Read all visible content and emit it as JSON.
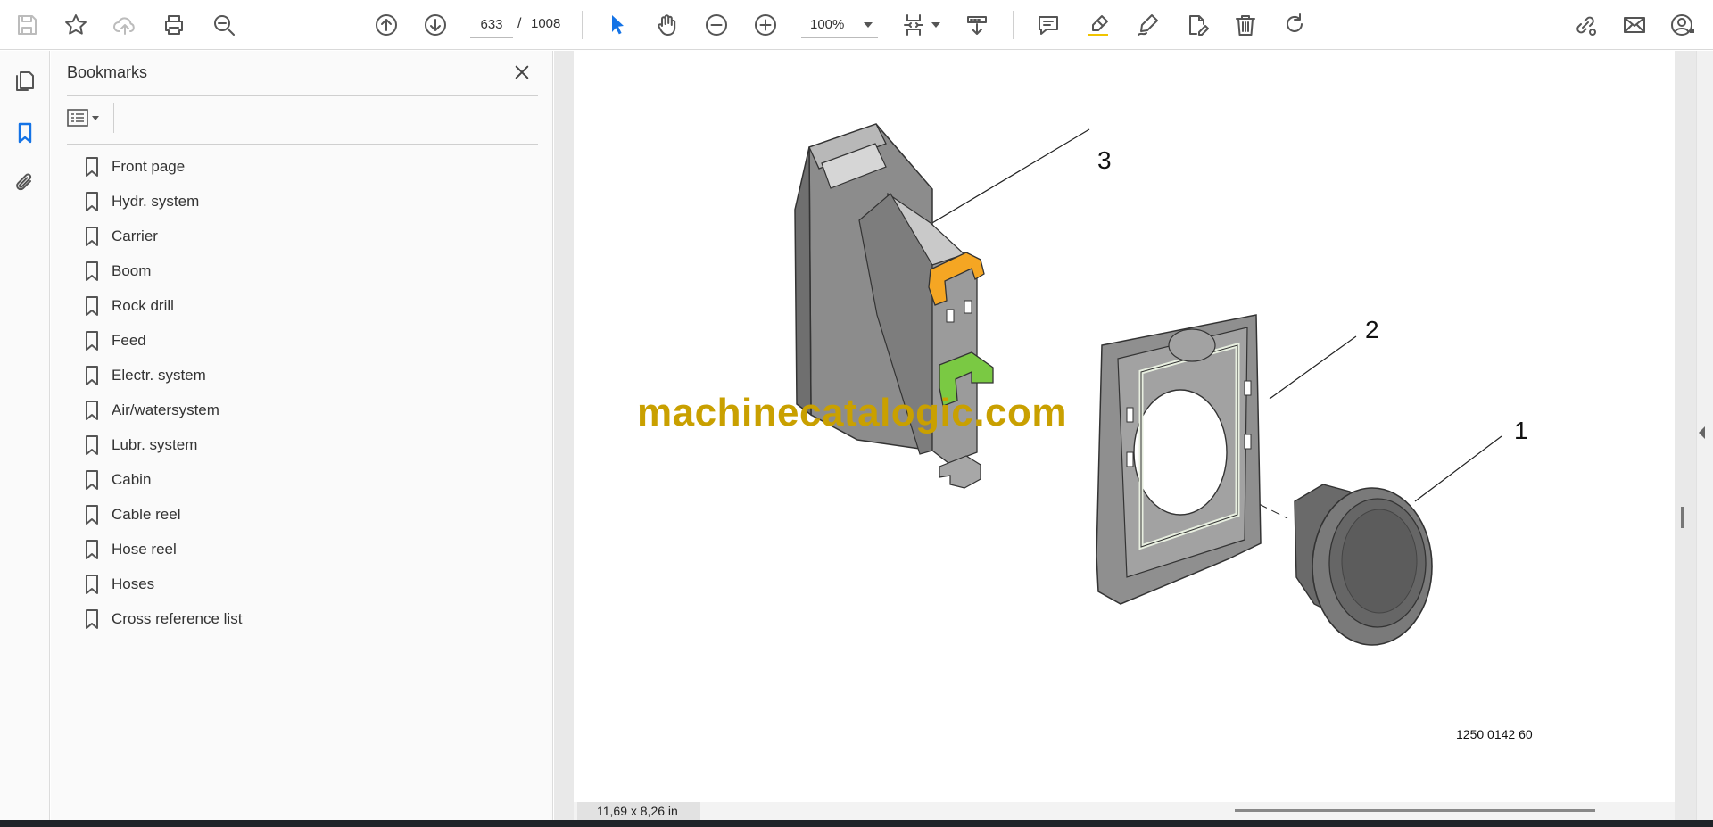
{
  "toolbar": {
    "page_current": "633",
    "page_separator": "/",
    "page_total": "1008",
    "zoom_value": "100%"
  },
  "bookmarks": {
    "title": "Bookmarks",
    "items": [
      {
        "label": "Front page"
      },
      {
        "label": "Hydr. system"
      },
      {
        "label": "Carrier"
      },
      {
        "label": "Boom"
      },
      {
        "label": "Rock drill"
      },
      {
        "label": "Feed"
      },
      {
        "label": "Electr. system"
      },
      {
        "label": "Air/watersystem"
      },
      {
        "label": "Lubr. system"
      },
      {
        "label": "Cabin"
      },
      {
        "label": "Cable reel"
      },
      {
        "label": "Hose reel"
      },
      {
        "label": "Hoses"
      },
      {
        "label": "Cross reference list"
      }
    ]
  },
  "document": {
    "watermark": "machinecatalogic.com",
    "figure_id": "1250 0142 60",
    "callouts": [
      "3",
      "2",
      "1"
    ],
    "part_colors": {
      "clip": "#f5a623",
      "latch": "#7ac943",
      "body": "#8a8a8a"
    }
  },
  "status": {
    "page_size": "11,69 x 8,26 in"
  },
  "icons": [
    "save-icon",
    "star-icon",
    "cloud-upload-icon",
    "print-icon",
    "zoom-search-icon",
    "page-up-icon",
    "page-down-icon",
    "zoom-out-icon",
    "zoom-in-icon",
    "select-cursor-icon",
    "hand-tool-icon",
    "fit-page-icon",
    "scroll-mode-icon",
    "comment-icon",
    "highlight-icon",
    "draw-icon",
    "fill-sign-icon",
    "delete-icon",
    "rotate-icon",
    "share-link-icon",
    "email-icon",
    "account-icon",
    "pages-icon",
    "bookmark-icon",
    "attachment-icon"
  ]
}
